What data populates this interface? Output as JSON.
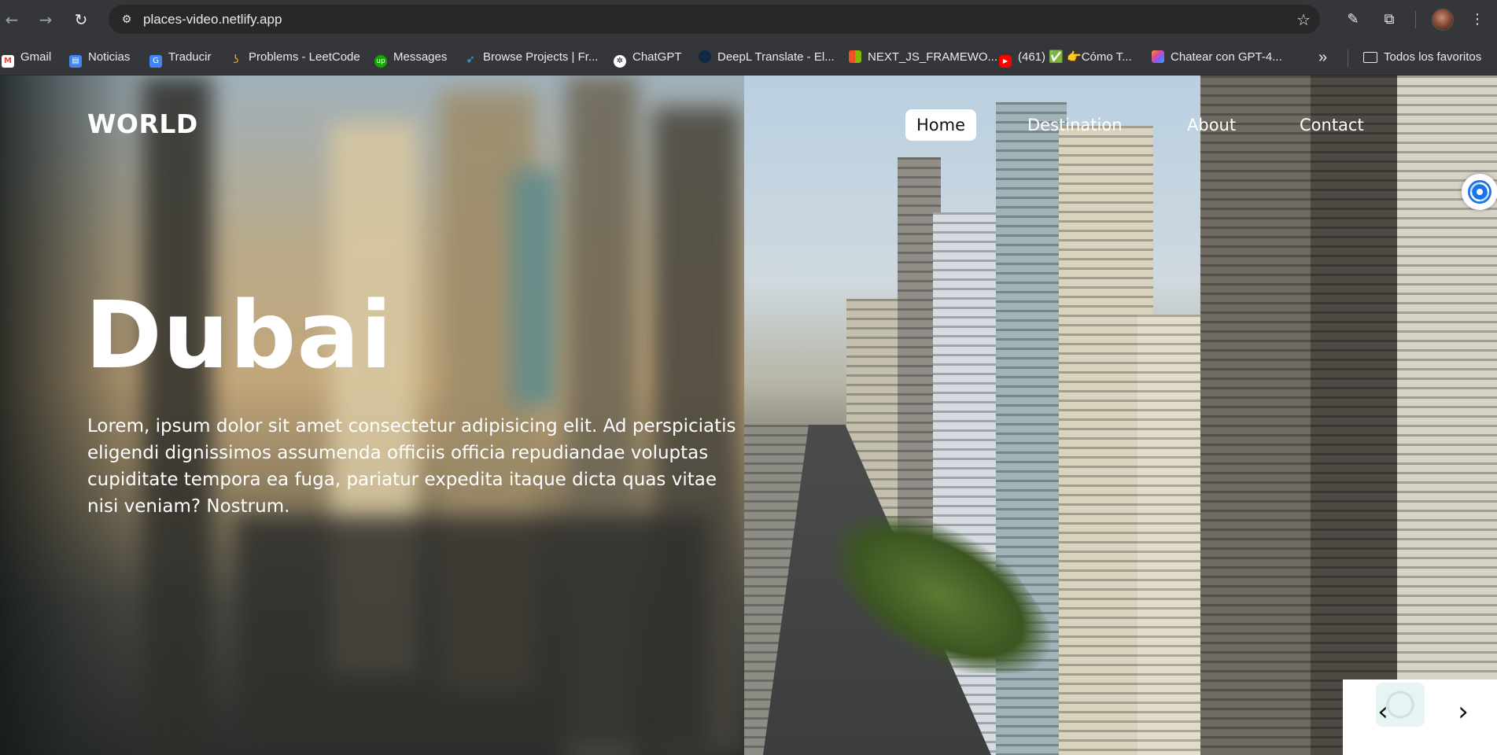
{
  "browser": {
    "url": "places-video.netlify.app",
    "icons": {
      "back": "arrow-left-icon",
      "forward": "arrow-right-icon",
      "reload": "reload-icon",
      "site_info": "tune-icon",
      "bookmark_star": "star-icon",
      "eyedropper": "eyedropper-icon",
      "extensions": "puzzle-icon",
      "menu": "kebab-menu-icon"
    },
    "bookmarks": [
      {
        "label": "Gmail",
        "icon": "gmail-icon",
        "color": "#ea4335"
      },
      {
        "label": "Noticias",
        "icon": "news-icon",
        "color": "#4285f4"
      },
      {
        "label": "Traducir",
        "icon": "translate-icon",
        "color": "#4285f4"
      },
      {
        "label": "Problems - LeetCode",
        "icon": "leetcode-icon",
        "color": "#f89f1b"
      },
      {
        "label": "Messages",
        "icon": "upwork-icon",
        "color": "#14a800"
      },
      {
        "label": "Browse Projects | Fr...",
        "icon": "freelancer-icon",
        "color": "#29b2fe"
      },
      {
        "label": "ChatGPT",
        "icon": "chatgpt-icon",
        "color": "#ffffff"
      },
      {
        "label": "DeepL Translate - El...",
        "icon": "deepl-icon",
        "color": "#0f2b46"
      },
      {
        "label": "NEXT_JS_FRAMEWO...",
        "icon": "microsoft-icon",
        "color": "#f25022"
      },
      {
        "label": "(461) ✅ 👉Cómo T...",
        "icon": "youtube-icon",
        "color": "#ff0000"
      },
      {
        "label": "Chatear con GPT-4...",
        "icon": "copilot-icon",
        "color": "#7b61ff"
      }
    ],
    "overflow_label": "»",
    "other_bookmarks": "Todos los favoritos"
  },
  "site": {
    "brand": "WORLD",
    "nav": [
      "Home",
      "Destination",
      "About",
      "Contact"
    ],
    "active_nav": "Home",
    "hero_title": "Dubai",
    "hero_text": "Lorem, ipsum dolor sit amet consectetur adipisicing elit. Ad perspiciatis eligendi dignissimos assumenda officiis officia repudiandae voluptas cupiditate tempora ea fuga, pariatur expedita itaque dicta quas vitae nisi veniam? Nostrum.",
    "slider": {
      "prev": "‹",
      "next": "›"
    }
  }
}
